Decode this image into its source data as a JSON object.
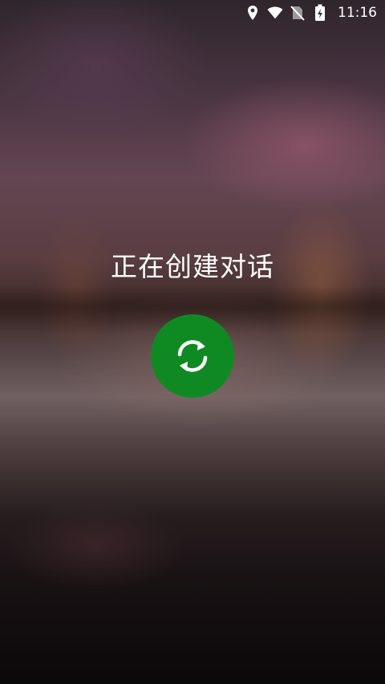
{
  "status_bar": {
    "time": "11:16",
    "icons": [
      "location-icon",
      "wifi-icon",
      "no-sim-icon",
      "battery-charging-icon"
    ]
  },
  "main": {
    "loading_text": "正在创建对话",
    "spinner_icon": "refresh-icon",
    "accent_color": "#0f8a22"
  }
}
